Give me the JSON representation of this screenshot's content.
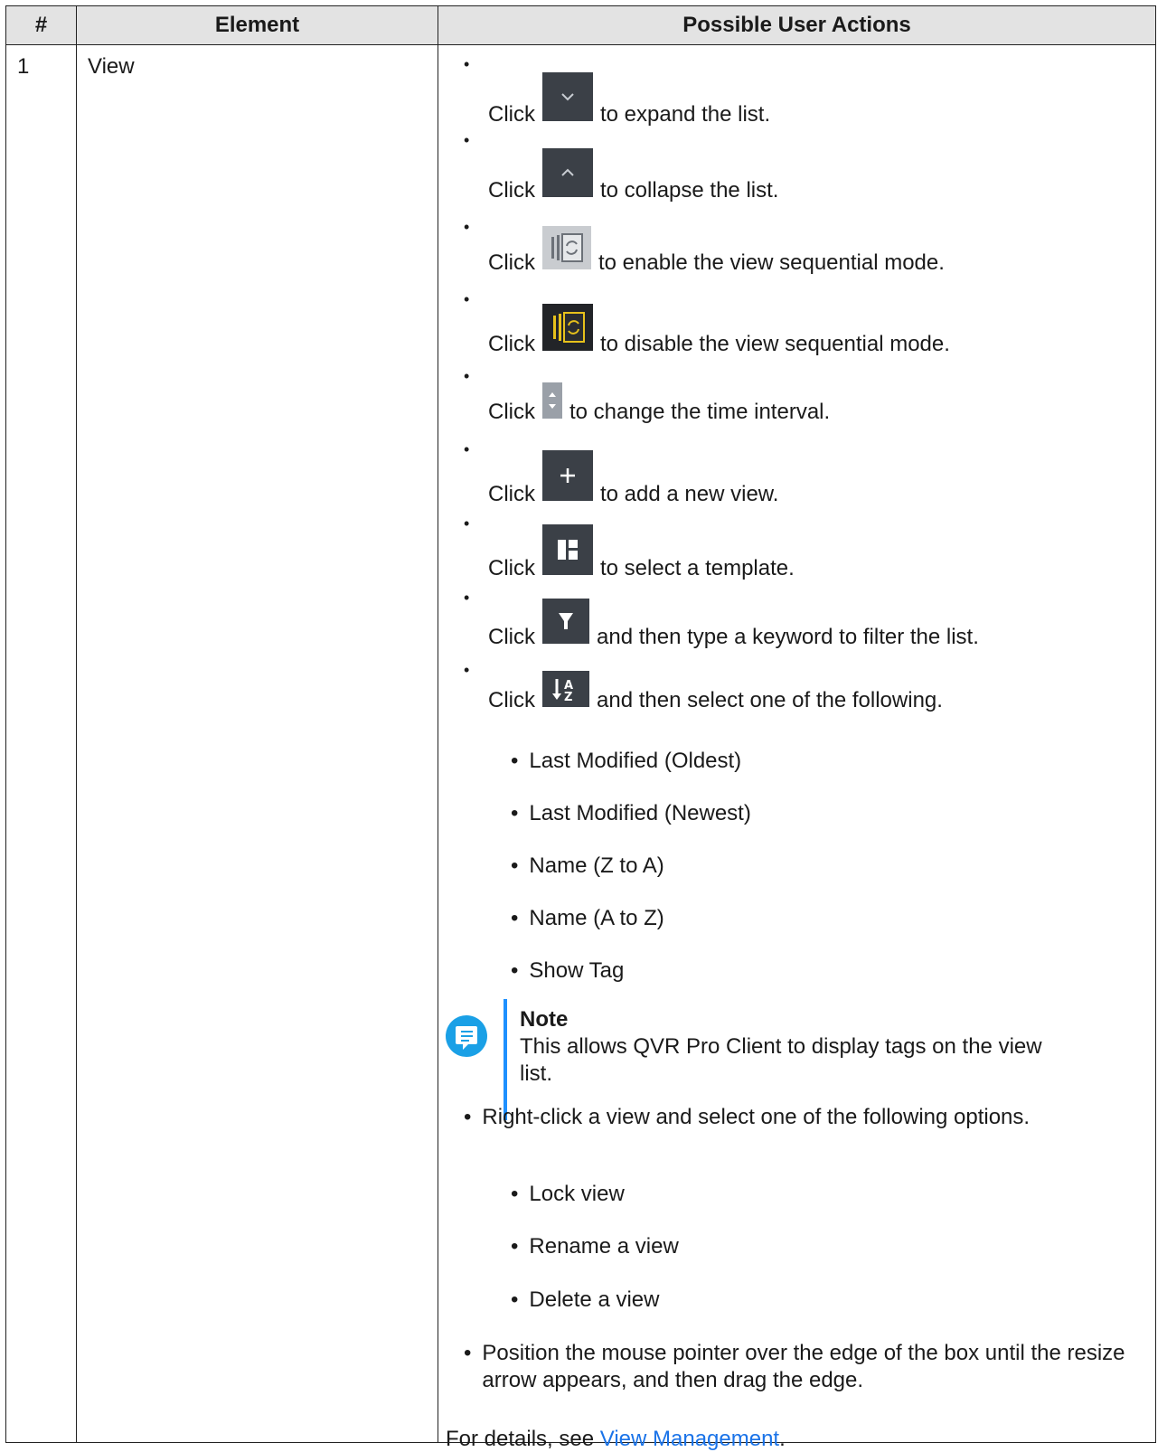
{
  "table": {
    "headers": [
      "#",
      "Element",
      "Possible User Actions"
    ],
    "row": {
      "num": "1",
      "element": "View"
    }
  },
  "actions": [
    {
      "pre": "Click",
      "icon": "chevron-down-icon",
      "post": "to expand the list."
    },
    {
      "pre": "Click",
      "icon": "chevron-up-icon",
      "post": "to collapse the list."
    },
    {
      "pre": "Click",
      "icon": "sequential-mode-icon",
      "post": "to enable the view sequential mode."
    },
    {
      "pre": "Click",
      "icon": "sequential-mode-active-icon",
      "post": "to disable the view sequential mode."
    },
    {
      "pre": "Click",
      "icon": "stepper-icon",
      "post": "to change the time interval."
    },
    {
      "pre": "Click",
      "icon": "plus-icon",
      "post": "to add a new view."
    },
    {
      "pre": "Click",
      "icon": "template-icon",
      "post": "to select a template."
    },
    {
      "pre": "Click",
      "icon": "filter-icon",
      "post": "and then type a keyword to filter the list."
    },
    {
      "pre": "Click",
      "icon": "sort-icon",
      "post": "and then select one of the following."
    }
  ],
  "sort_options": [
    "Last Modified (Oldest)",
    "Last Modified (Newest)",
    "Name (Z to A)",
    "Name (A to Z)",
    "Show Tag"
  ],
  "note": {
    "title": "Note",
    "text": "This allows QVR Pro Client to display tags on the view list."
  },
  "right_click": {
    "text": "Right-click a view and select one of the following options.",
    "options": [
      "Lock view",
      "Rename a view",
      "Delete a view"
    ]
  },
  "resize_text": "Position the mouse pointer over the edge of the box until the resize arrow appears, and then drag the edge.",
  "footer": {
    "prefix": "For details, see ",
    "link": "View Management",
    "suffix": "."
  },
  "bullet": "•"
}
